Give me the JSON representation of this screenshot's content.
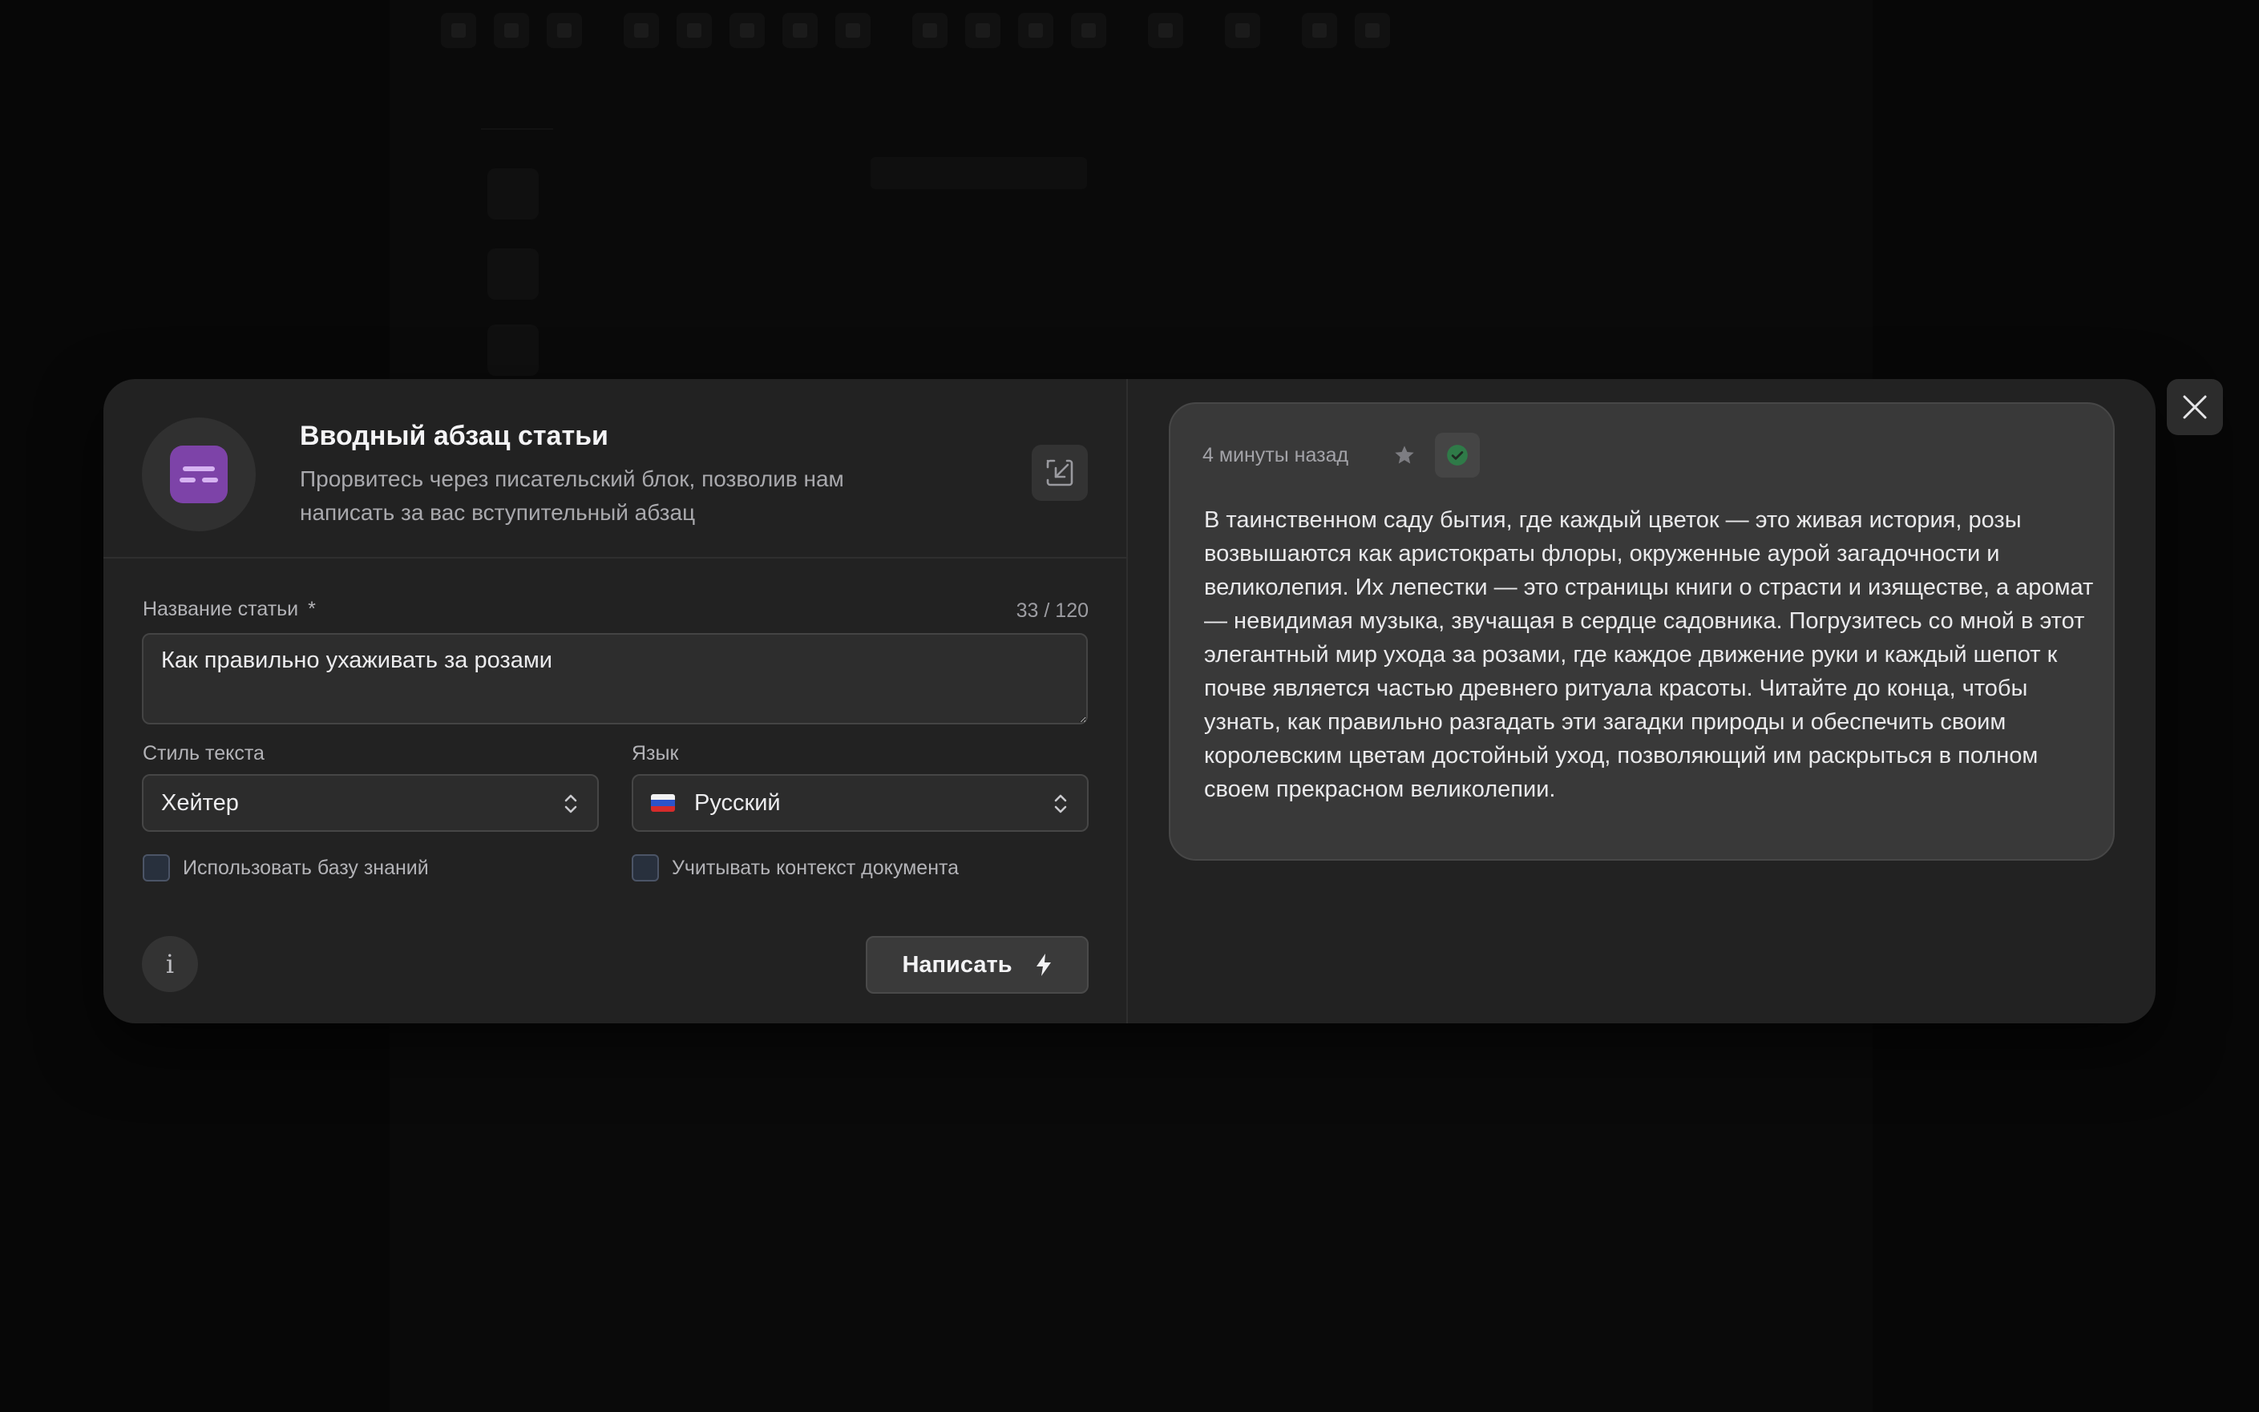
{
  "modal": {
    "header": {
      "title": "Вводный абзац статьи",
      "subtitle": "Прорвитесь через писательский блок, позволив нам написать за вас вступительный абзац",
      "block_icon": "text-lines-icon",
      "block_icon_color": "#7d43a8",
      "collapse_icon": "collapse-arrow-icon"
    },
    "form": {
      "title_field": {
        "label": "Название статьи",
        "required_mark": "*",
        "value": "Как правильно ухаживать за розами",
        "counter": "33 / 120"
      },
      "style_field": {
        "label": "Стиль текста",
        "value": "Хейтер"
      },
      "language_field": {
        "label": "Язык",
        "value": "Русский",
        "flag": "russia-flag-icon"
      },
      "checkboxes": {
        "knowledge_base": "Использовать базу знаний",
        "document_context": "Учитывать контекст документа"
      },
      "info_label": "i",
      "submit_label": "Написать",
      "submit_icon": "lightning-icon"
    },
    "result": {
      "timestamp": "4 минуты назад",
      "star_icon": "star-icon",
      "check_icon": "check-circle-icon",
      "check_color": "#3aa85f",
      "text": "В таинственном саду бытия, где каждый цветок — это живая история, розы возвышаются как аристократы флоры, окруженные аурой загадочности и великолепия. Их лепестки — это страницы книги о страсти и изяществе, а аромат — невидимая музыка, звучащая в сердце садовника. Погрузитесь со мной в этот элегантный мир ухода за розами, где каждое движение руки и каждый шепот к почве является частью древнего ритуала красоты. Читайте до конца, чтобы узнать, как правильно разгадать эти загадки природы и обеспечить своим королевским цветам достойный уход, позволяющий им раскрыться в полном своем прекрасном великолепии."
    },
    "close_icon": "close-icon"
  }
}
